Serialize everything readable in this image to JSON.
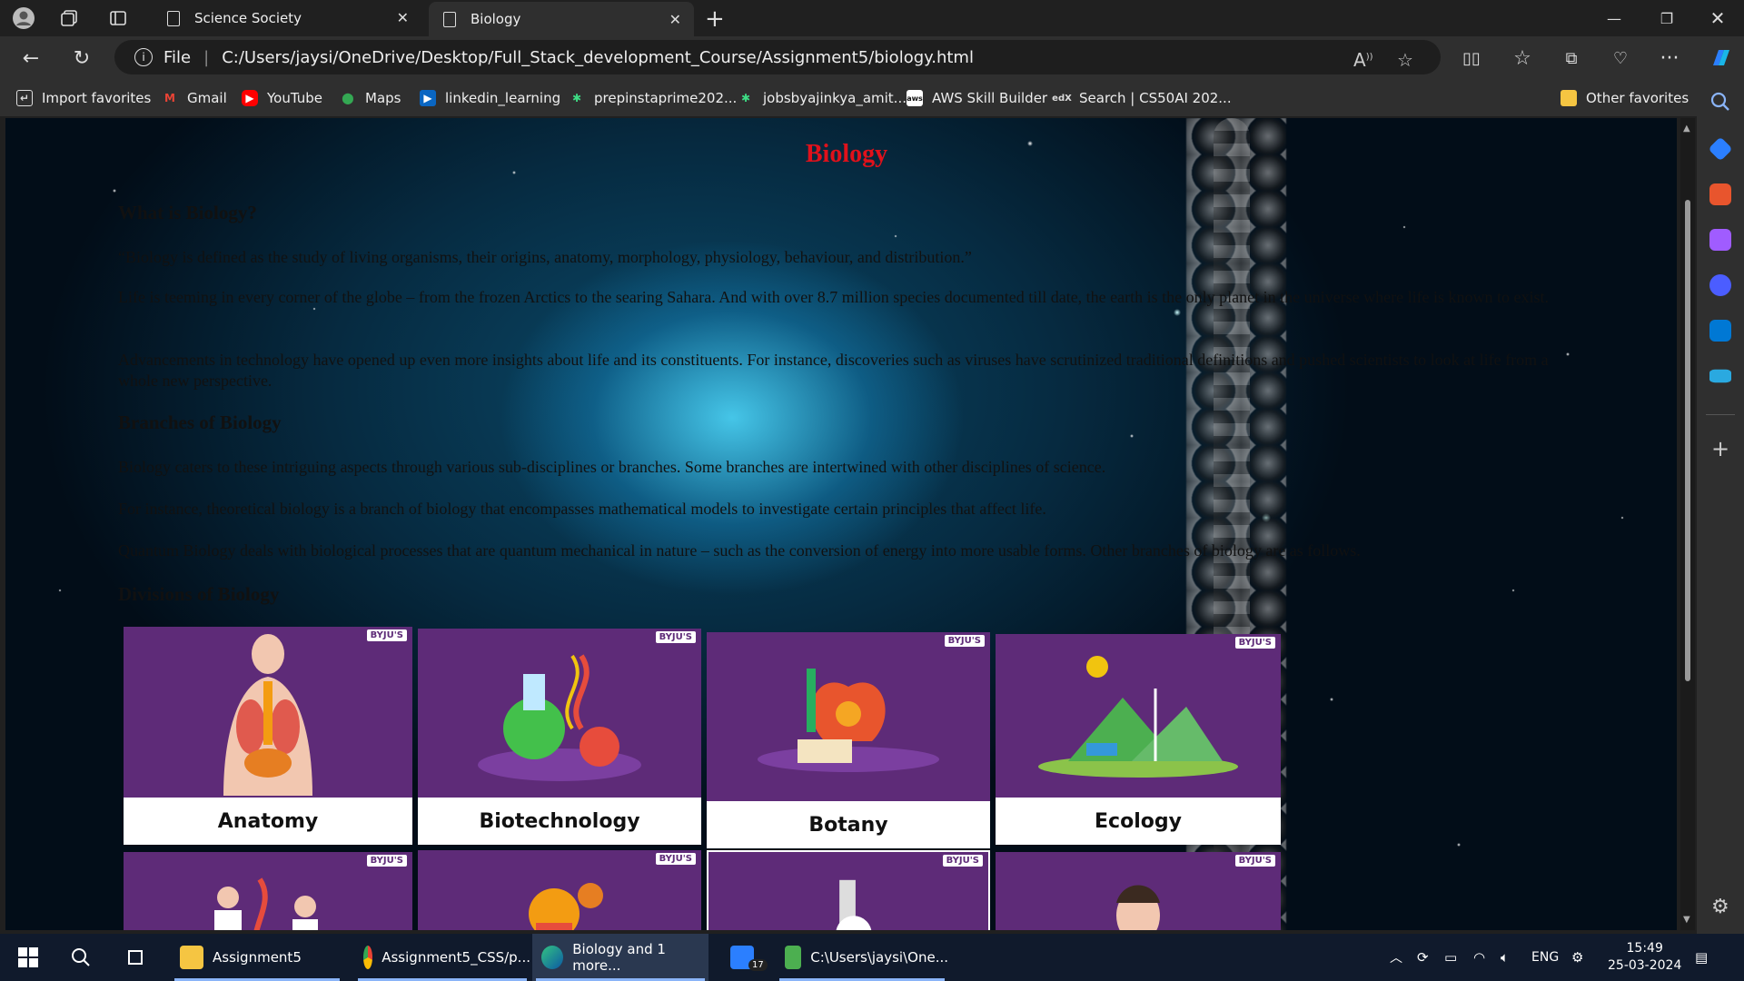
{
  "browser": {
    "tabs": [
      {
        "label": "Science Society"
      },
      {
        "label": "Biology"
      }
    ],
    "address": {
      "scheme": "File",
      "url": "C:/Users/jaysi/OneDrive/Desktop/Full_Stack_development_Course/Assignment5/biology.html"
    },
    "favorites": [
      {
        "label": "Import favorites",
        "icon": "import-icon"
      },
      {
        "label": "Gmail",
        "icon": "gmail-icon"
      },
      {
        "label": "YouTube",
        "icon": "youtube-icon"
      },
      {
        "label": "Maps",
        "icon": "maps-icon"
      },
      {
        "label": "linkedin_learning",
        "icon": "linkedin-icon"
      },
      {
        "label": "prepinstaprime202...",
        "icon": "prepinsta-icon"
      },
      {
        "label": "jobsbyajinkya_amit...",
        "icon": "jobs-icon"
      },
      {
        "label": "AWS Skill Builder",
        "icon": "aws-icon"
      },
      {
        "label": "Search | CS50AI 202...",
        "icon": "edx-icon"
      }
    ],
    "other_favorites": "Other favorites",
    "accent": "#2b7fff"
  },
  "page": {
    "title": "Biology",
    "title_color": "#e0111b",
    "section1": {
      "heading": "What is Biology?",
      "paragraphs": [
        "“Biology is defined as the study of living organisms, their origins, anatomy, morphology, physiology, behaviour, and distribution.”",
        "Life is teeming in every corner of the globe – from the frozen Arctics to the searing Sahara. And with over 8.7 million species documented till date, the earth is the only planet in the universe where life is known to exist.",
        "Advancements in technology have opened up even more insights about life and its constituents. For instance, discoveries such as viruses have scrutinized traditional definitions and pushed scientists to look at life from a whole new perspective."
      ]
    },
    "section2": {
      "heading": "Branches of Biology",
      "paragraphs": [
        "Biology caters to these intriguing aspects through various sub-disciplines or branches. Some branches are intertwined with other disciplines of science.",
        "For instance, theoretical biology is a branch of biology that encompasses mathematical models to investigate certain principles that affect life.",
        "Quantum Biology deals with biological processes that are quantum mechanical in nature – such as the conversion of energy into more usable forms. Other branches of biology are as follows."
      ]
    },
    "section3": {
      "heading": "Divisions of Biology"
    },
    "cards": [
      {
        "label": "Anatomy",
        "brand": "BYJU'S"
      },
      {
        "label": "Biotechnology",
        "brand": "BYJU'S"
      },
      {
        "label": "Botany",
        "brand": "BYJU'S"
      },
      {
        "label": "Ecology",
        "brand": "BYJU'S"
      },
      {
        "label": "",
        "brand": "BYJU'S"
      },
      {
        "label": "",
        "brand": "BYJU'S"
      },
      {
        "label": "",
        "brand": "BYJU'S"
      },
      {
        "label": "",
        "brand": "BYJU'S"
      }
    ]
  },
  "taskbar": {
    "items": [
      {
        "label": "Assignment5",
        "icon": "folder-icon"
      },
      {
        "label": "Assignment5_CSS/p...",
        "icon": "chrome-icon"
      },
      {
        "label": "Biology and 1 more...",
        "icon": "edge-icon"
      },
      {
        "label": "",
        "icon": "mail-icon",
        "badge": "17"
      },
      {
        "label": "C:\\Users\\jaysi\\One...",
        "icon": "notepad-icon"
      }
    ],
    "lang": "ENG",
    "time": "15:49",
    "date": "25-03-2024"
  }
}
